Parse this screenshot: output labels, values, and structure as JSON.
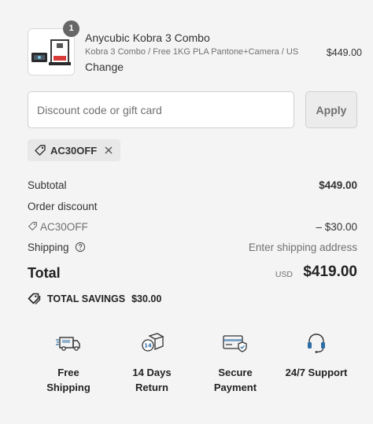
{
  "product": {
    "quantity": "1",
    "name": "Anycubic Kobra 3 Combo",
    "variant": "Kobra 3 Combo / Free 1KG PLA Pantone+Camera / US",
    "change_label": "Change",
    "price": "$449.00"
  },
  "discount": {
    "placeholder": "Discount code or gift card",
    "apply_label": "Apply",
    "applied_code": "AC30OFF"
  },
  "summary": {
    "subtotal_label": "Subtotal",
    "subtotal_value": "$449.00",
    "order_discount_label": "Order discount",
    "discount_code": "AC30OFF",
    "discount_value": "– $30.00",
    "shipping_label": "Shipping",
    "shipping_value": "Enter shipping address",
    "total_label": "Total",
    "currency": "USD",
    "total_value": "$419.00",
    "savings_label": "TOTAL SAVINGS",
    "savings_value": "$30.00"
  },
  "features": [
    {
      "icon": "truck-icon",
      "line1": "Free",
      "line2": "Shipping"
    },
    {
      "icon": "return-box-icon",
      "line1": "14 Days",
      "line2": "Return"
    },
    {
      "icon": "secure-card-icon",
      "line1": "Secure",
      "line2": "Payment"
    },
    {
      "icon": "headset-icon",
      "line1": "24/7 Support",
      "line2": ""
    }
  ],
  "colors": {
    "background": "#f4f4f4",
    "text": "#333333",
    "muted": "#707070",
    "icon_accent": "#2f6ea5"
  }
}
